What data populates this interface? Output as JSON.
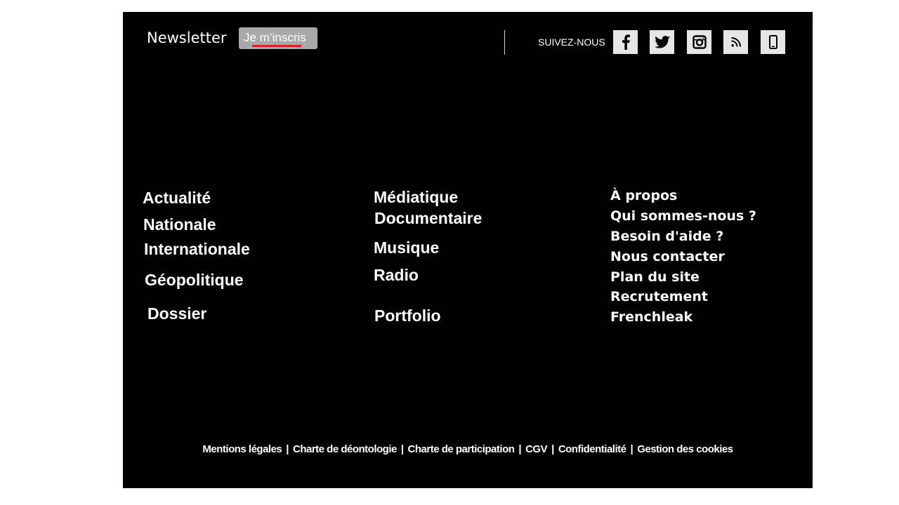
{
  "newsletter": {
    "title": "Newsletter",
    "button_label": "Je m’inscris"
  },
  "follow": {
    "label": "SUIVEZ-NOUS",
    "networks": [
      {
        "icon": "facebook-icon"
      },
      {
        "icon": "twitter-icon"
      },
      {
        "icon": "instagram-icon"
      },
      {
        "icon": "rss-icon"
      },
      {
        "icon": "mobile-app-icon"
      }
    ]
  },
  "nav": {
    "col1": [
      "Actualité",
      "Nationale",
      "Internationale",
      "Géopolitique",
      "Dossier"
    ],
    "col2": [
      "Médiatique",
      "Documentaire",
      "Musique",
      "Radio",
      "Portfolio"
    ],
    "col3": [
      "À propos",
      "Qui sommes-nous ?",
      "Besoin d'aide ?",
      "Nous contacter",
      "Plan du site",
      "Recrutement",
      "Frenchleak"
    ]
  },
  "legal": {
    "links": [
      "Mentions légales",
      "Charte de déontologie",
      "Charte de participation",
      "CGV",
      "Confidentialité",
      "Gestion des cookies"
    ],
    "separator": "|"
  },
  "colors": {
    "background": "#000000",
    "button_bg": "#a9a9a9",
    "accent_underline": "#d81e2a",
    "social_bg": "#e6e6e6"
  }
}
